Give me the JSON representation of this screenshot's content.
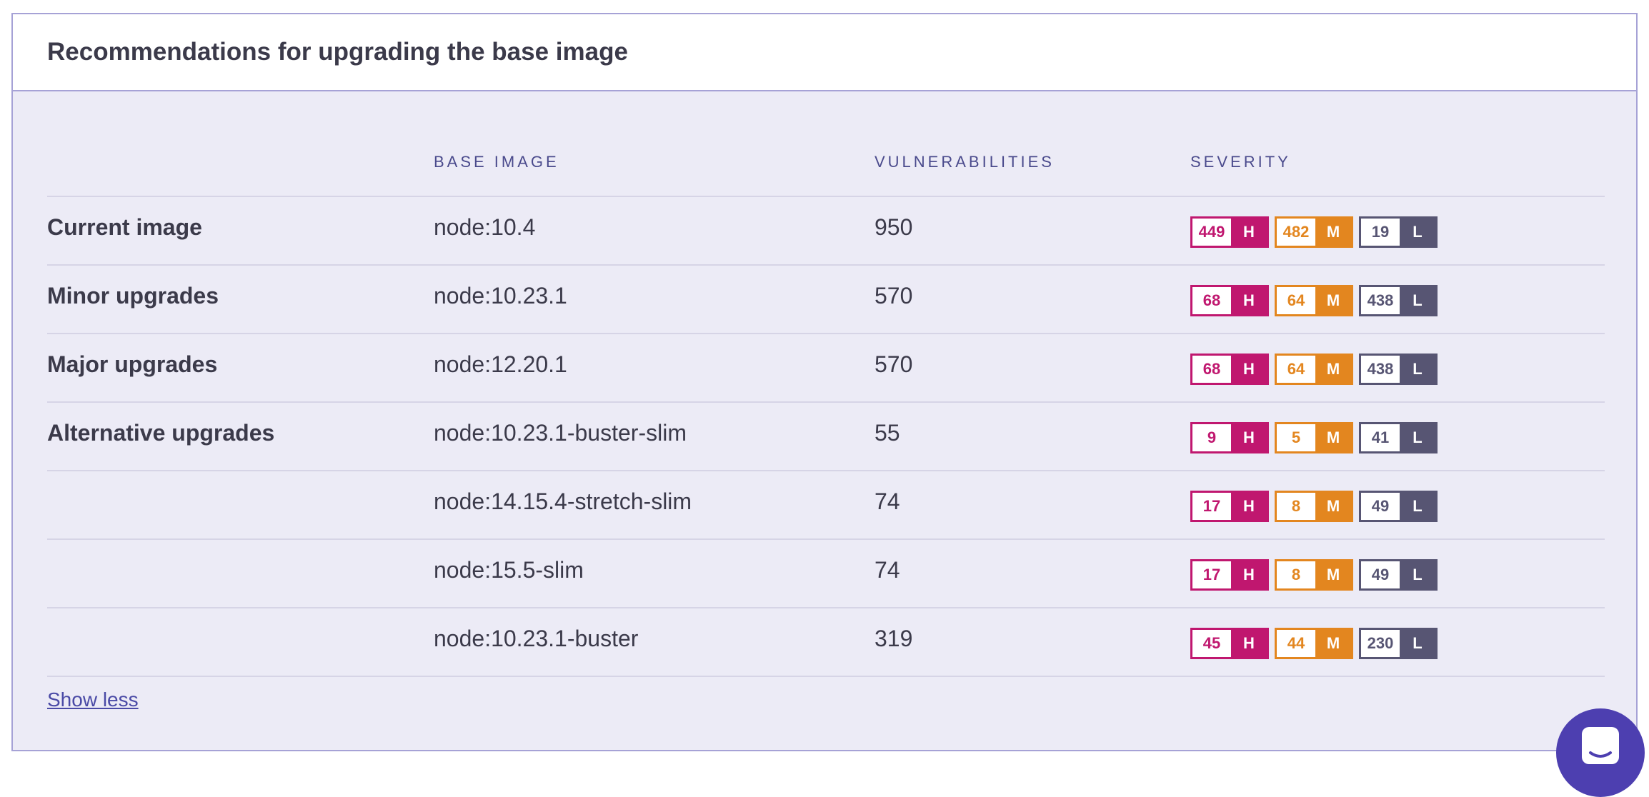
{
  "panel": {
    "title": "Recommendations for upgrading the base image",
    "show_less_label": "Show less"
  },
  "table": {
    "headers": {
      "base_image": "BASE IMAGE",
      "vulnerabilities": "VULNERABILITIES",
      "severity": "SEVERITY"
    },
    "rows": [
      {
        "label": "Current image",
        "image": "node:10.4",
        "vulns": "950",
        "high": "449",
        "medium": "482",
        "low": "19"
      },
      {
        "label": "Minor upgrades",
        "image": "node:10.23.1",
        "vulns": "570",
        "high": "68",
        "medium": "64",
        "low": "438"
      },
      {
        "label": "Major upgrades",
        "image": "node:12.20.1",
        "vulns": "570",
        "high": "68",
        "medium": "64",
        "low": "438"
      },
      {
        "label": "Alternative upgrades",
        "image": "node:10.23.1-buster-slim",
        "vulns": "55",
        "high": "9",
        "medium": "5",
        "low": "41"
      },
      {
        "label": "",
        "image": "node:14.15.4-stretch-slim",
        "vulns": "74",
        "high": "17",
        "medium": "8",
        "low": "49"
      },
      {
        "label": "",
        "image": "node:15.5-slim",
        "vulns": "74",
        "high": "17",
        "medium": "8",
        "low": "49"
      },
      {
        "label": "",
        "image": "node:10.23.1-buster",
        "vulns": "319",
        "high": "45",
        "medium": "44",
        "low": "230"
      }
    ],
    "severity_letters": {
      "high": "H",
      "medium": "M",
      "low": "L"
    }
  },
  "colors": {
    "high": "#c0176f",
    "medium": "#e3861f",
    "low": "#575573",
    "accent": "#4d3fb0",
    "panel_bg": "#ecebf6"
  },
  "icons": {
    "chat": "chat-icon"
  }
}
